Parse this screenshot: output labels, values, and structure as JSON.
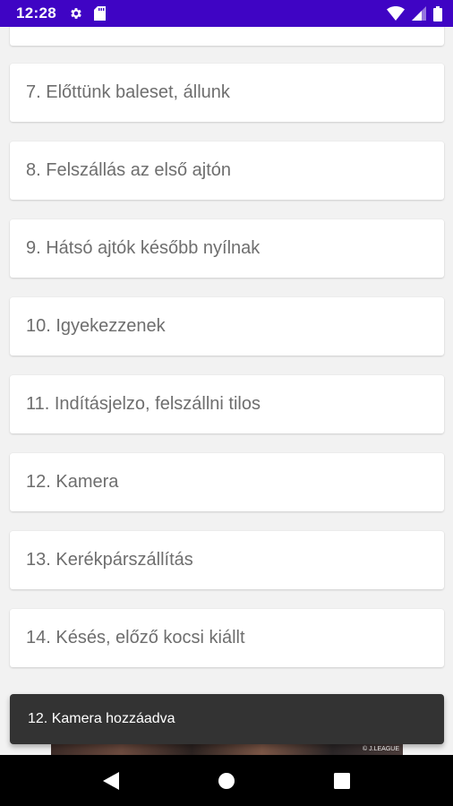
{
  "status_bar": {
    "time": "12:28",
    "background_color": "#3f04c4",
    "icons_left": [
      "gear-icon",
      "sd-card-icon"
    ],
    "icons_right": [
      "wifi-icon",
      "signal-icon",
      "battery-icon"
    ]
  },
  "list": {
    "items": [
      {
        "label": ""
      },
      {
        "label": "7. Előttünk baleset, állunk"
      },
      {
        "label": "8. Felszállás az első ajtón"
      },
      {
        "label": "9. Hátsó ajtók később nyílnak"
      },
      {
        "label": "10. Igyekezzenek"
      },
      {
        "label": "11. Indításjelzo, felszállni tilos"
      },
      {
        "label": "12. Kamera"
      },
      {
        "label": "13. Kerékpárszállítás"
      },
      {
        "label": "14. Késés, előző kocsi kiállt"
      }
    ]
  },
  "ad_banner": {
    "text": "© J.LEAGUE"
  },
  "snackbar": {
    "message": "12. Kamera hozzáadva"
  },
  "nav_bar": {
    "buttons": [
      "back-icon",
      "home-icon",
      "recents-icon"
    ]
  }
}
